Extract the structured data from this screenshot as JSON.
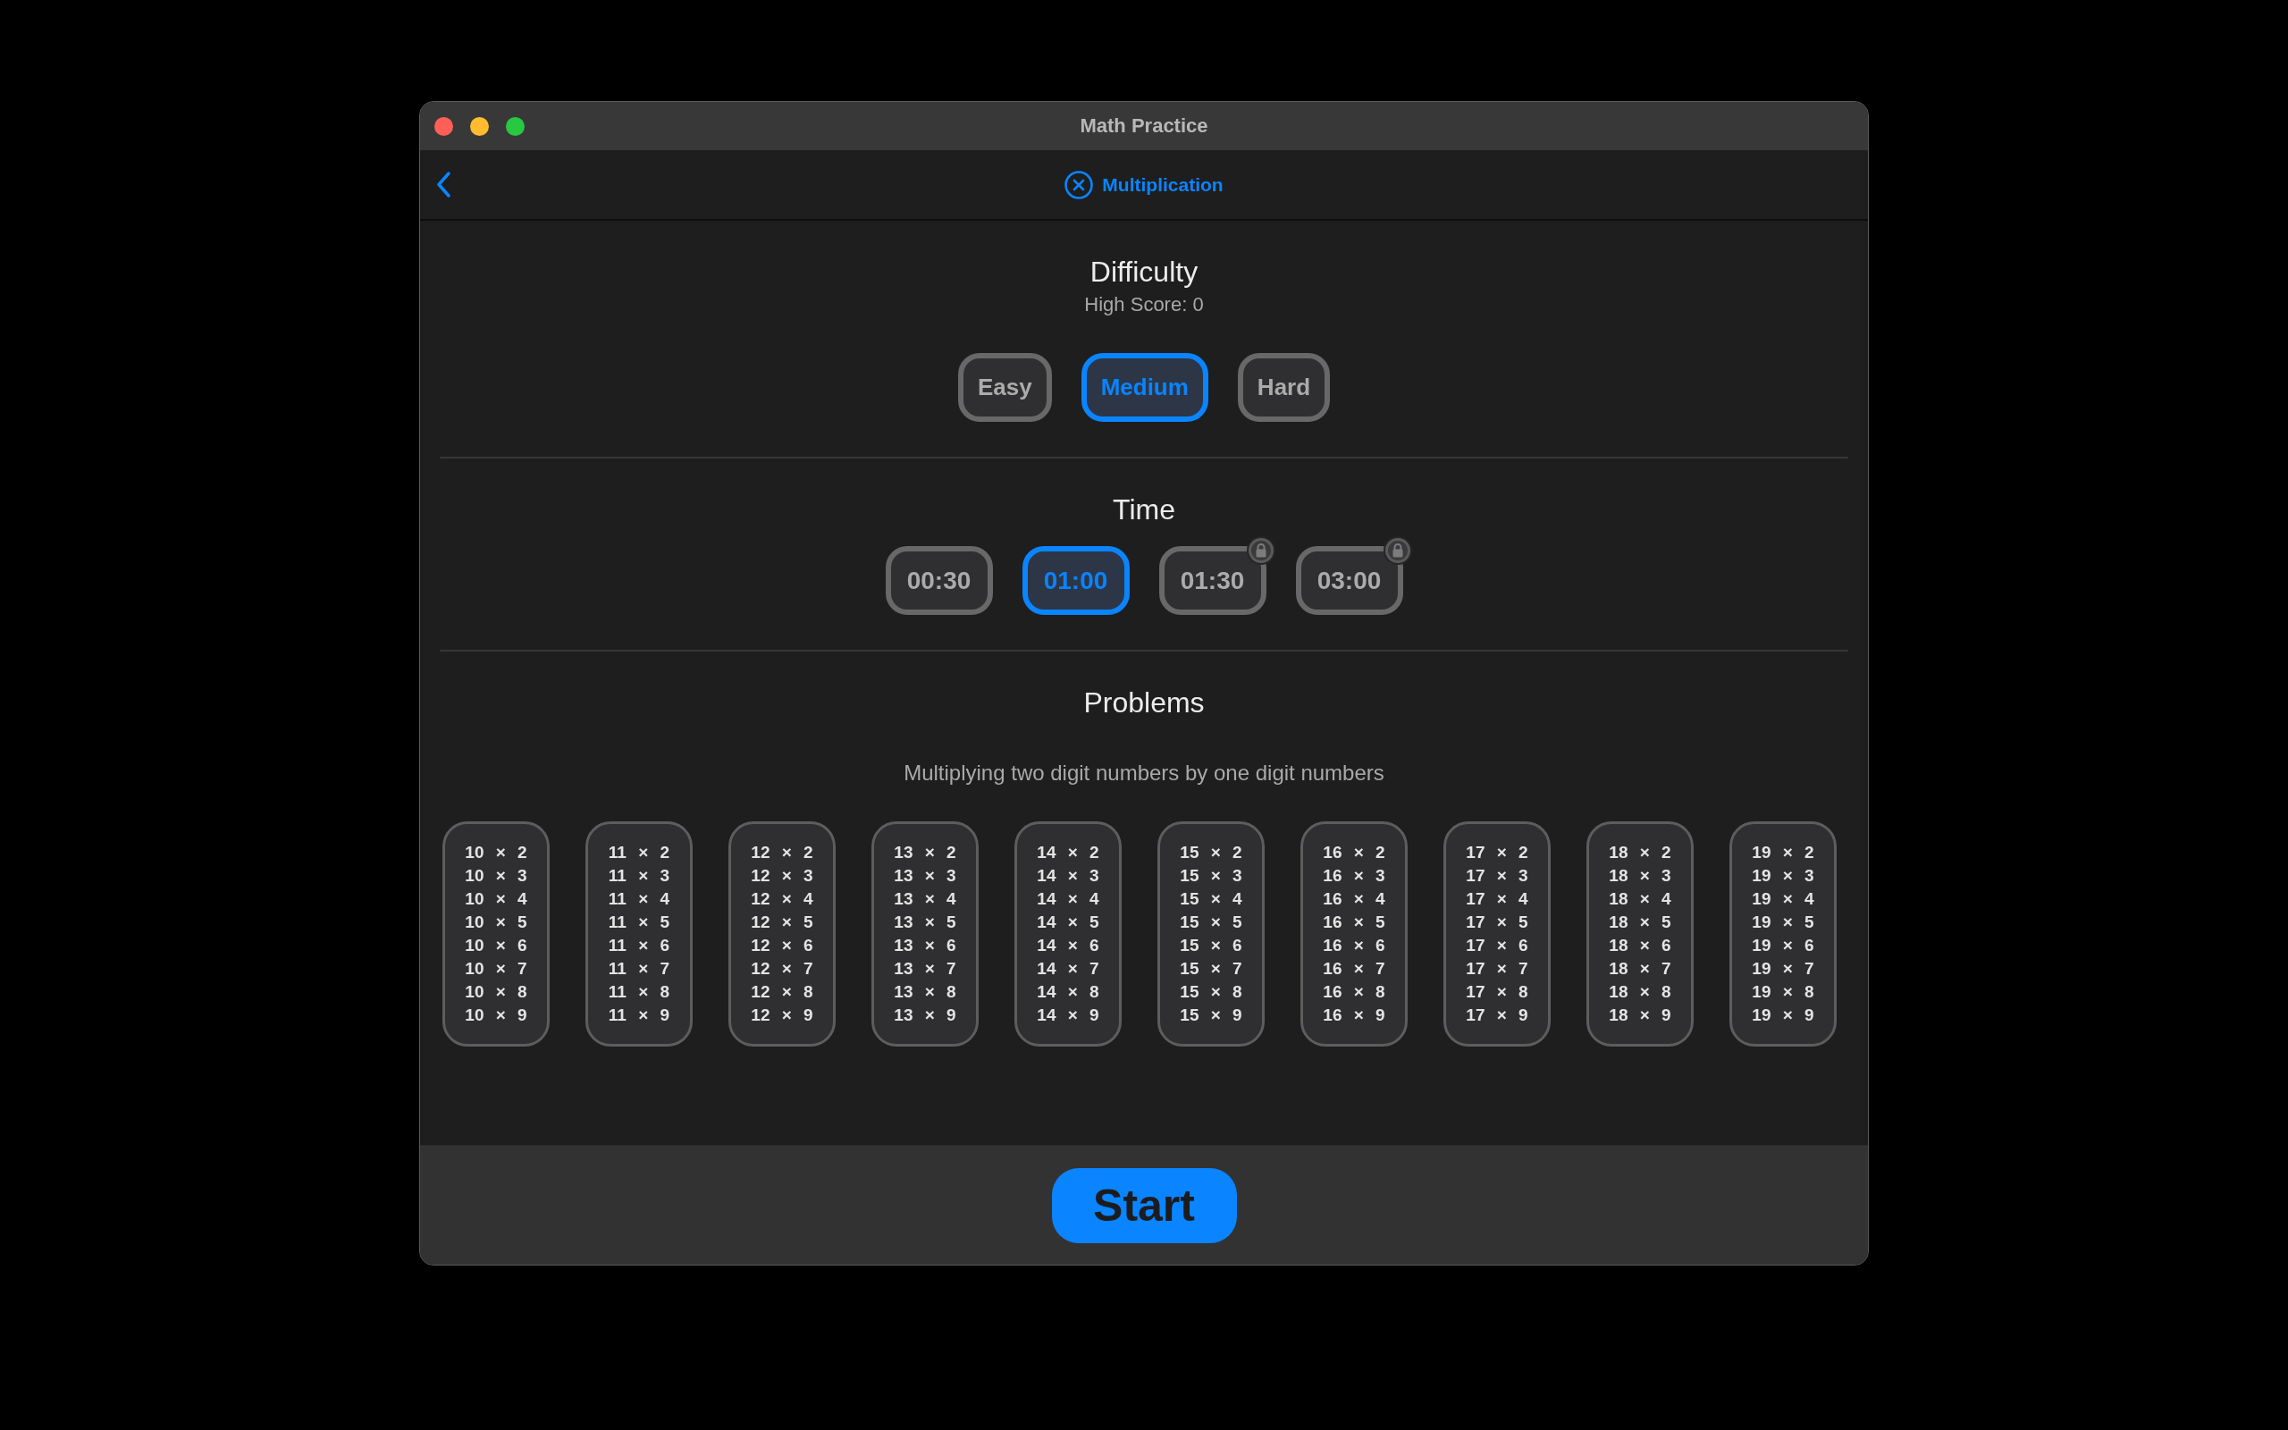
{
  "window": {
    "title": "Math Practice"
  },
  "toolbar": {
    "title": "Multiplication"
  },
  "difficulty": {
    "title": "Difficulty",
    "high_score": "High Score: 0",
    "options": [
      {
        "label": "Easy",
        "selected": false
      },
      {
        "label": "Medium",
        "selected": true
      },
      {
        "label": "Hard",
        "selected": false
      }
    ]
  },
  "time": {
    "title": "Time",
    "options": [
      {
        "label": "00:30",
        "selected": false,
        "locked": false
      },
      {
        "label": "01:00",
        "selected": true,
        "locked": false
      },
      {
        "label": "01:30",
        "selected": false,
        "locked": true
      },
      {
        "label": "03:00",
        "selected": false,
        "locked": true
      }
    ]
  },
  "problems": {
    "title": "Problems",
    "subtitle": "Multiplying two digit numbers by one digit numbers",
    "groups": [
      {
        "lines": [
          "10 × 2",
          "10 × 3",
          "10 × 4",
          "10 × 5",
          "10 × 6",
          "10 × 7",
          "10 × 8",
          "10 × 9"
        ]
      },
      {
        "lines": [
          "11 × 2",
          "11 × 3",
          "11 × 4",
          "11 × 5",
          "11 × 6",
          "11 × 7",
          "11 × 8",
          "11 × 9"
        ]
      },
      {
        "lines": [
          "12 × 2",
          "12 × 3",
          "12 × 4",
          "12 × 5",
          "12 × 6",
          "12 × 7",
          "12 × 8",
          "12 × 9"
        ]
      },
      {
        "lines": [
          "13 × 2",
          "13 × 3",
          "13 × 4",
          "13 × 5",
          "13 × 6",
          "13 × 7",
          "13 × 8",
          "13 × 9"
        ]
      },
      {
        "lines": [
          "14 × 2",
          "14 × 3",
          "14 × 4",
          "14 × 5",
          "14 × 6",
          "14 × 7",
          "14 × 8",
          "14 × 9"
        ]
      },
      {
        "lines": [
          "15 × 2",
          "15 × 3",
          "15 × 4",
          "15 × 5",
          "15 × 6",
          "15 × 7",
          "15 × 8",
          "15 × 9"
        ]
      },
      {
        "lines": [
          "16 × 2",
          "16 × 3",
          "16 × 4",
          "16 × 5",
          "16 × 6",
          "16 × 7",
          "16 × 8",
          "16 × 9"
        ]
      },
      {
        "lines": [
          "17 × 2",
          "17 × 3",
          "17 × 4",
          "17 × 5",
          "17 × 6",
          "17 × 7",
          "17 × 8",
          "17 × 9"
        ]
      },
      {
        "lines": [
          "18 × 2",
          "18 × 3",
          "18 × 4",
          "18 × 5",
          "18 × 6",
          "18 × 7",
          "18 × 8",
          "18 × 9"
        ]
      },
      {
        "lines": [
          "19 × 2",
          "19 × 3",
          "19 × 4",
          "19 × 5",
          "19 × 6",
          "19 × 7",
          "19 × 8",
          "19 × 9"
        ]
      }
    ]
  },
  "start_button": {
    "label": "Start"
  }
}
